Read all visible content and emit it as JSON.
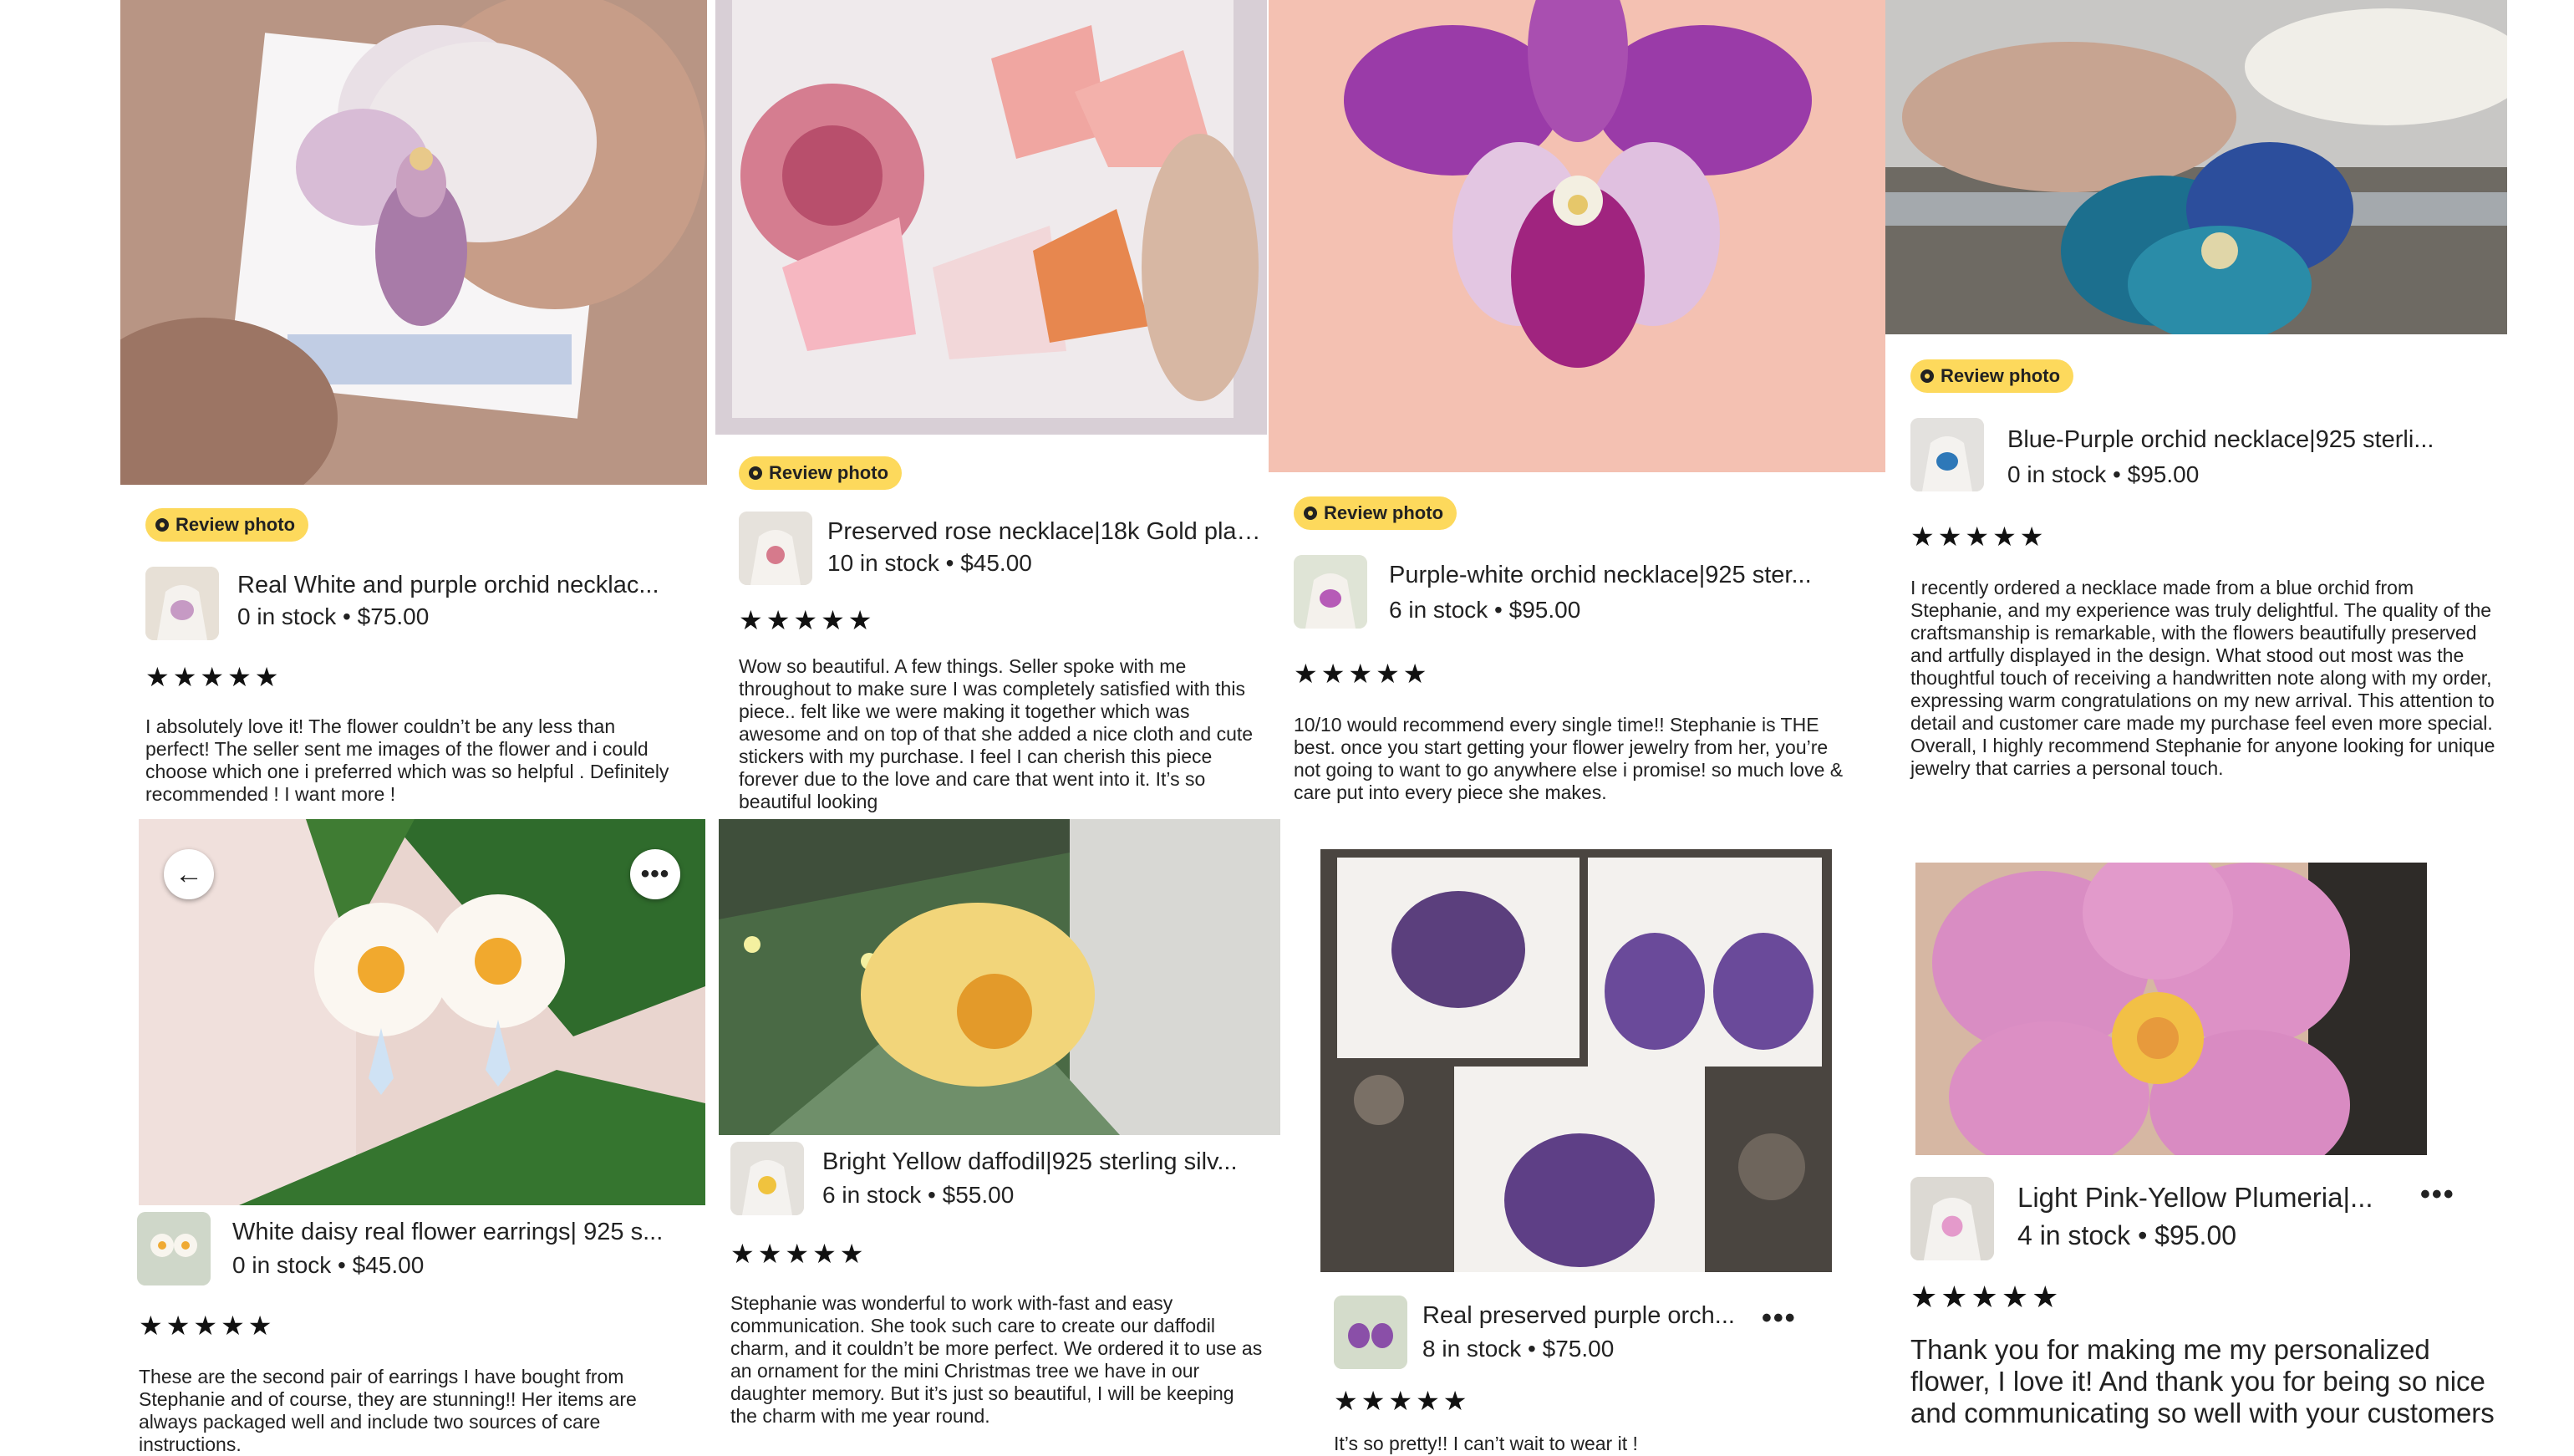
{
  "badge_label": "Review photo",
  "cards": [
    {
      "title": "Real White and purple orchid necklac...",
      "meta": "0 in stock • $75.00",
      "stars": "★★★★★",
      "review": "I absolutely love it! The flower couldn’t be any less than perfect! The seller sent me images of the flower and i could choose which one i preferred which was so helpful . Definitely recommended ! I want more !"
    },
    {
      "title": "Preserved rose necklace|18k Gold plat...",
      "meta": "10 in stock • $45.00",
      "stars": "★★★★★",
      "review": "Wow so beautiful. A few things. Seller spoke with me throughout to make sure I was completely satisfied with this piece.. felt like we were making it together which was awesome and on top of that she added a nice cloth and cute stickers with my purchase. I feel I can cherish this piece forever due to the love and care that went into it. It’s so beautiful  looking"
    },
    {
      "title": "Purple-white orchid necklace|925 ster...",
      "meta": "6 in stock • $95.00",
      "stars": "★★★★★",
      "review": "10/10 would recommend every single time!! Stephanie is THE best. once you start getting your flower jewelry from her, you’re not going to want to go anywhere else i promise! so much love & care put into every piece she makes."
    },
    {
      "title": "Blue-Purple orchid necklace|925 sterli...",
      "meta": "0 in stock • $95.00",
      "stars": "★★★★★",
      "review": "I recently ordered a necklace made from a blue orchid from Stephanie, and my experience was truly delightful. The quality of the craftsmanship is remarkable, with the flowers beautifully preserved and artfully displayed in the design. What stood out most was the thoughtful touch of receiving a handwritten note along with my order, expressing warm congratulations on my new arrival. This attention to detail and customer care made my purchase feel even more special. Overall, I highly recommend Stephanie for anyone looking for unique jewelry that carries a personal touch."
    },
    {
      "title": "White daisy real flower earrings| 925 s...",
      "meta": "0 in stock • $45.00",
      "stars": "★★★★★",
      "review": "These are the second pair of earrings I have bought from Stephanie and of course, they are stunning!! Her items are always packaged well and include two sources of care instructions."
    },
    {
      "title": "Bright Yellow daffodil|925 sterling silv...",
      "meta": "6 in stock • $55.00",
      "stars": "★★★★★",
      "review": "Stephanie was wonderful to work with-fast and easy communication. She took such care to create our daffodil charm, and it couldn’t be more perfect. We ordered it to use as an ornament for the mini Christmas tree we have in our daughter memory. But it’s just so beautiful, I will be keeping the charm with me year round."
    },
    {
      "title": "Real preserved purple orch...",
      "meta": "8 in stock • $75.00",
      "stars": "★★★★★",
      "review": "It’s so pretty!! I can’t wait to wear it !"
    },
    {
      "title": "Light Pink-Yellow Plumeria|...",
      "meta": "4 in stock • $95.00",
      "stars": "★★★★★",
      "review": "Thank you for making me my personalized flower, I love it! And thank you for being so nice and communicating so well with your customers"
    }
  ]
}
